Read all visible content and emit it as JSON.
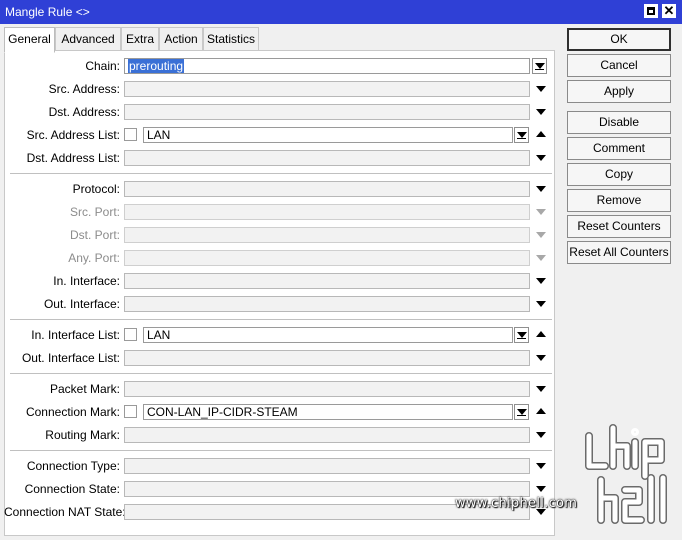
{
  "window": {
    "title": "Mangle Rule <>"
  },
  "tabs": [
    {
      "label": "General",
      "active": true
    },
    {
      "label": "Advanced",
      "active": false
    },
    {
      "label": "Extra",
      "active": false
    },
    {
      "label": "Action",
      "active": false
    },
    {
      "label": "Statistics",
      "active": false
    }
  ],
  "fields": {
    "chain": {
      "label": "Chain:",
      "value": "prerouting"
    },
    "src_address": {
      "label": "Src. Address:",
      "value": ""
    },
    "dst_address": {
      "label": "Dst. Address:",
      "value": ""
    },
    "src_address_list": {
      "label": "Src. Address List:",
      "value": "LAN"
    },
    "dst_address_list": {
      "label": "Dst. Address List:",
      "value": ""
    },
    "protocol": {
      "label": "Protocol:",
      "value": ""
    },
    "src_port": {
      "label": "Src. Port:",
      "value": ""
    },
    "dst_port": {
      "label": "Dst. Port:",
      "value": ""
    },
    "any_port": {
      "label": "Any. Port:",
      "value": ""
    },
    "in_interface": {
      "label": "In. Interface:",
      "value": ""
    },
    "out_interface": {
      "label": "Out. Interface:",
      "value": ""
    },
    "in_interface_list": {
      "label": "In. Interface List:",
      "value": "LAN"
    },
    "out_interface_list": {
      "label": "Out. Interface List:",
      "value": ""
    },
    "packet_mark": {
      "label": "Packet Mark:",
      "value": ""
    },
    "connection_mark": {
      "label": "Connection Mark:",
      "value": "CON-LAN_IP-CIDR-STEAM"
    },
    "routing_mark": {
      "label": "Routing Mark:",
      "value": ""
    },
    "connection_type": {
      "label": "Connection Type:",
      "value": ""
    },
    "connection_state": {
      "label": "Connection State:",
      "value": ""
    },
    "connection_nat_state": {
      "label": "Connection NAT State:",
      "value": ""
    }
  },
  "buttons": {
    "ok": "OK",
    "cancel": "Cancel",
    "apply": "Apply",
    "disable": "Disable",
    "comment": "Comment",
    "copy": "Copy",
    "remove": "Remove",
    "reset_counters": "Reset Counters",
    "reset_all_counters": "Reset All Counters"
  },
  "watermark": {
    "url": "www.chiphell.com",
    "logo_icon": "chiphell-logo-icon"
  },
  "colors": {
    "titlebar": "#2f40d6",
    "selection": "#3a70d6"
  }
}
